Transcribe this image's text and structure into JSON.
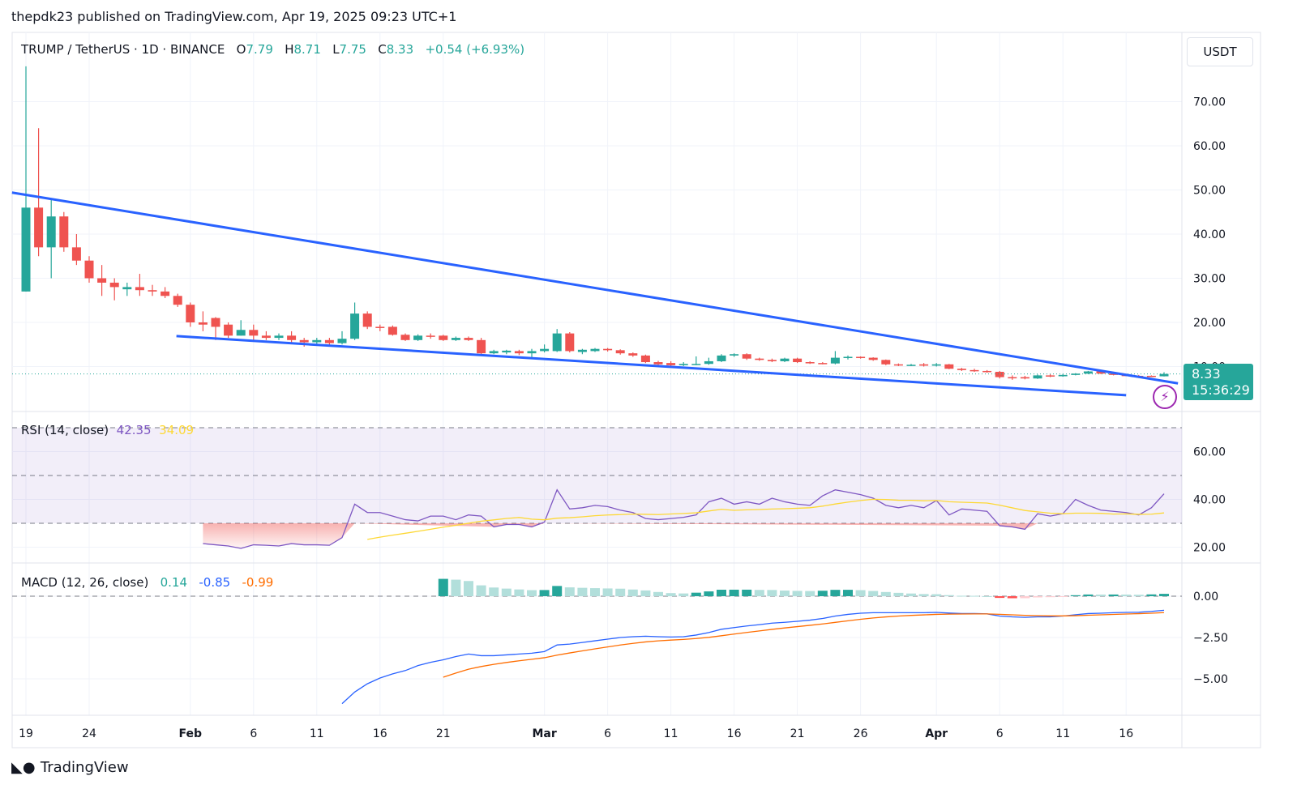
{
  "header": {
    "publisher": "thepdk23 published on TradingView.com, Apr 19, 2025 09:23 UTC+1"
  },
  "legend": {
    "symbol": "TRUMP / TetherUS · 1D · BINANCE",
    "o_label": "O",
    "o": "7.79",
    "h_label": "H",
    "h": "8.71",
    "l_label": "L",
    "l": "7.75",
    "c_label": "C",
    "c": "8.33",
    "change": "+0.54 (+6.93%)"
  },
  "currency": "USDT",
  "last_price": {
    "price": "8.33",
    "countdown": "15:36:29"
  },
  "rsi_legend": {
    "title": "RSI (14, close)",
    "rsi": "42.35",
    "ma": "34.09"
  },
  "macd_legend": {
    "title": "MACD (12, 26, close)",
    "hist": "0.14",
    "macd": "-0.85",
    "signal": "-0.99"
  },
  "footer": {
    "brand": "TradingView"
  },
  "colors": {
    "up": "#26a69a",
    "down": "#ef5350",
    "trend": "#2962ff",
    "rsi": "#7e57c2",
    "rsi_ma": "#fdd835",
    "macd": "#2962ff",
    "signal": "#ff6d00"
  },
  "chart_data": [
    {
      "type": "candlestick",
      "title": "TRUMP / TetherUS · 1D · BINANCE",
      "ylim": [
        0,
        78
      ],
      "y_ticks": [
        "70.00",
        "60.00",
        "50.00",
        "40.00",
        "30.00",
        "20.00",
        "10.00"
      ],
      "y_tick_values": [
        70,
        60,
        50,
        40,
        30,
        20,
        10
      ],
      "x_ticks": [
        {
          "label": "19",
          "index": 0
        },
        {
          "label": "24",
          "index": 5
        },
        {
          "label": "Feb",
          "index": 13
        },
        {
          "label": "6",
          "index": 18
        },
        {
          "label": "11",
          "index": 23
        },
        {
          "label": "16",
          "index": 28
        },
        {
          "label": "21",
          "index": 33
        },
        {
          "label": "Mar",
          "index": 41
        },
        {
          "label": "6",
          "index": 46
        },
        {
          "label": "11",
          "index": 51
        },
        {
          "label": "16",
          "index": 56
        },
        {
          "label": "21",
          "index": 61
        },
        {
          "label": "26",
          "index": 66
        },
        {
          "label": "Apr",
          "index": 72
        },
        {
          "label": "6",
          "index": 77
        },
        {
          "label": "11",
          "index": 82
        },
        {
          "label": "16",
          "index": 87
        }
      ],
      "candles_ohlc": [
        [
          27,
          78,
          27,
          46
        ],
        [
          46,
          64,
          35,
          37
        ],
        [
          37,
          48,
          30,
          44
        ],
        [
          44,
          45,
          36,
          37
        ],
        [
          37,
          40,
          33,
          34
        ],
        [
          34,
          35,
          29,
          30
        ],
        [
          30,
          33,
          26,
          29
        ],
        [
          29,
          30,
          25,
          28
        ],
        [
          27.5,
          29,
          26,
          28
        ],
        [
          28,
          31,
          26,
          27.3
        ],
        [
          27.3,
          28.5,
          26,
          27
        ],
        [
          27,
          28,
          25.5,
          26
        ],
        [
          26,
          26.5,
          23.5,
          24
        ],
        [
          24,
          24.5,
          19,
          20
        ],
        [
          20,
          22.5,
          18,
          19.5
        ],
        [
          21,
          21.2,
          16,
          19
        ],
        [
          19.5,
          20,
          16.5,
          17
        ],
        [
          17,
          20.5,
          17,
          18.3
        ],
        [
          18.3,
          19.5,
          16,
          17
        ],
        [
          17,
          18,
          16,
          16.5
        ],
        [
          16.5,
          17.5,
          16,
          17
        ],
        [
          17,
          18,
          15.5,
          16
        ],
        [
          16,
          16.5,
          14.5,
          15.5
        ],
        [
          15.5,
          16.5,
          15,
          16
        ],
        [
          16,
          16.5,
          14.8,
          15.3
        ],
        [
          15.3,
          18,
          15,
          16.3
        ],
        [
          16.3,
          24.5,
          16,
          22
        ],
        [
          22,
          22.5,
          18.5,
          19
        ],
        [
          19,
          19.5,
          18,
          18.8
        ],
        [
          19,
          19.3,
          17,
          17.2
        ],
        [
          17.2,
          17.5,
          15.8,
          16
        ],
        [
          16,
          17.3,
          15.8,
          17
        ],
        [
          17,
          17.5,
          16.3,
          16.8
        ],
        [
          17,
          17.2,
          15.8,
          16
        ],
        [
          16,
          16.8,
          15.8,
          16.5
        ],
        [
          16.5,
          16.8,
          15.8,
          16
        ],
        [
          16,
          16.5,
          12.5,
          13
        ],
        [
          13,
          13.8,
          12.8,
          13.5
        ],
        [
          13.2,
          13.8,
          12.8,
          13.6
        ],
        [
          13.5,
          13.8,
          12.6,
          13
        ],
        [
          13,
          14,
          12,
          13.5
        ],
        [
          13.5,
          15,
          13.2,
          14
        ],
        [
          13.5,
          18.5,
          13.3,
          17.5
        ],
        [
          17.5,
          17.8,
          13.2,
          13.5
        ],
        [
          13.3,
          14,
          12.8,
          13.8
        ],
        [
          13.5,
          14.2,
          13.3,
          14
        ],
        [
          14,
          14.2,
          13.4,
          13.7
        ],
        [
          13.7,
          13.9,
          12.7,
          13
        ],
        [
          13,
          13.2,
          12.2,
          12.5
        ],
        [
          12.5,
          12.7,
          10.8,
          11
        ],
        [
          11,
          11.3,
          10.3,
          10.5
        ],
        [
          10.8,
          11.2,
          10.1,
          10.3
        ],
        [
          10.3,
          11,
          10.1,
          10.6
        ],
        [
          10.5,
          12.3,
          10.3,
          10.6
        ],
        [
          10.6,
          12,
          10.4,
          11.2
        ],
        [
          11.2,
          12.8,
          11,
          12.5
        ],
        [
          12.5,
          13,
          12.2,
          12.8
        ],
        [
          12.8,
          13,
          11.5,
          11.8
        ],
        [
          11.8,
          12,
          11.3,
          11.5
        ],
        [
          11.5,
          11.8,
          11,
          11.2
        ],
        [
          11.2,
          12,
          11,
          11.8
        ],
        [
          11.8,
          12,
          10.8,
          11
        ],
        [
          11,
          11.2,
          10.6,
          10.8
        ],
        [
          10.8,
          11,
          10.5,
          10.7
        ],
        [
          10.7,
          13.5,
          10.5,
          12
        ],
        [
          12,
          12.5,
          11.6,
          12.2
        ],
        [
          12.2,
          12.3,
          11.8,
          12
        ],
        [
          12,
          12.1,
          11.3,
          11.5
        ],
        [
          11.5,
          11.6,
          10.3,
          10.5
        ],
        [
          10.5,
          10.7,
          10.1,
          10.3
        ],
        [
          10.3,
          10.6,
          10.1,
          10.4
        ],
        [
          10.5,
          10.8,
          10,
          10.2
        ],
        [
          10.2,
          10.8,
          10,
          10.5
        ],
        [
          10.5,
          10.6,
          9.4,
          9.5
        ],
        [
          9.5,
          9.7,
          9,
          9.2
        ],
        [
          9.2,
          9.5,
          8.8,
          9
        ],
        [
          9,
          9.2,
          8.6,
          8.8
        ],
        [
          8.8,
          9,
          7.3,
          7.6
        ],
        [
          7.6,
          8,
          7,
          7.4
        ],
        [
          7.6,
          7.9,
          7.1,
          7.3
        ],
        [
          7.3,
          8.2,
          7.2,
          8
        ],
        [
          8,
          8.3,
          7.6,
          7.8
        ],
        [
          7.8,
          8.3,
          7.7,
          8.1
        ],
        [
          8.1,
          8.5,
          8,
          8.4
        ],
        [
          8.4,
          9,
          8.3,
          8.9
        ],
        [
          8.9,
          9,
          8.3,
          8.4
        ],
        [
          8.4,
          8.6,
          8,
          8.1
        ],
        [
          8.1,
          8.3,
          7.8,
          7.9
        ],
        [
          7.9,
          8.1,
          7.7,
          7.8
        ],
        [
          7.9,
          8,
          7.7,
          7.79
        ],
        [
          7.79,
          8.71,
          7.75,
          8.33
        ]
      ],
      "trendlines": [
        {
          "name": "upper",
          "points": [
            [
              -1.1,
              49.4
            ],
            [
              91.1,
              6.2
            ]
          ]
        },
        {
          "name": "lower",
          "points": [
            [
              11.9,
              16.9
            ],
            [
              87,
              3.5
            ]
          ]
        }
      ]
    },
    {
      "type": "line",
      "title": "RSI (14, close)",
      "ylim": [
        14,
        78
      ],
      "y_ticks": [
        "60.00",
        "40.00",
        "20.00"
      ],
      "y_tick_values": [
        60,
        40,
        20
      ],
      "bands": [
        70,
        50,
        30
      ],
      "start_index": 14,
      "rsi": [
        21.5,
        21,
        20.5,
        19.5,
        21,
        20.8,
        20.5,
        21.5,
        21,
        21,
        20.8,
        24,
        38,
        34.5,
        34.5,
        33,
        31.5,
        31,
        33,
        33,
        31.5,
        33.5,
        33,
        28.5,
        29.5,
        29.5,
        28.5,
        30.5,
        44,
        36,
        36.5,
        37.5,
        37,
        35.5,
        34.5,
        32,
        31.5,
        32,
        32.5,
        33.5,
        39,
        40.5,
        38,
        39,
        38,
        40.5,
        39,
        38,
        37.5,
        41.5,
        44,
        43,
        42,
        40.5,
        37.5,
        36.5,
        37.5,
        36.5,
        39.5,
        33.5,
        36,
        35.5,
        35,
        29,
        28.5,
        27.5,
        34,
        33,
        34,
        40,
        37.5,
        35.5,
        35,
        34.5,
        33.5,
        36.5,
        42.35
      ],
      "ma_period": 14
    },
    {
      "type": "line",
      "title": "MACD (12, 26, close)",
      "ylim": [
        -7,
        1.8
      ],
      "y_ticks": [
        "0.00",
        "−2.50",
        "−5.00"
      ],
      "y_tick_values": [
        0,
        -2.5,
        -5
      ],
      "start_index": 25,
      "macd": [
        -6.5,
        -5.8,
        -5.3,
        -4.95,
        -4.7,
        -4.5,
        -4.2,
        -4.0,
        -3.85,
        -3.65,
        -3.5,
        -3.6,
        -3.6,
        -3.55,
        -3.5,
        -3.45,
        -3.35,
        -2.95,
        -2.9,
        -2.8,
        -2.7,
        -2.6,
        -2.5,
        -2.45,
        -2.42,
        -2.45,
        -2.47,
        -2.45,
        -2.35,
        -2.2,
        -2.0,
        -1.9,
        -1.8,
        -1.72,
        -1.63,
        -1.58,
        -1.52,
        -1.45,
        -1.35,
        -1.2,
        -1.1,
        -1.03,
        -1.0,
        -1.0,
        -1.0,
        -1.0,
        -1.0,
        -0.98,
        -1.02,
        -1.05,
        -1.05,
        -1.07,
        -1.2,
        -1.25,
        -1.28,
        -1.25,
        -1.25,
        -1.2,
        -1.12,
        -1.05,
        -1.03,
        -1.0,
        -0.98,
        -0.97,
        -0.92,
        -0.85
      ],
      "signal_start_index": 33,
      "signal_seed": -4.9,
      "signal_period": 9
    }
  ]
}
